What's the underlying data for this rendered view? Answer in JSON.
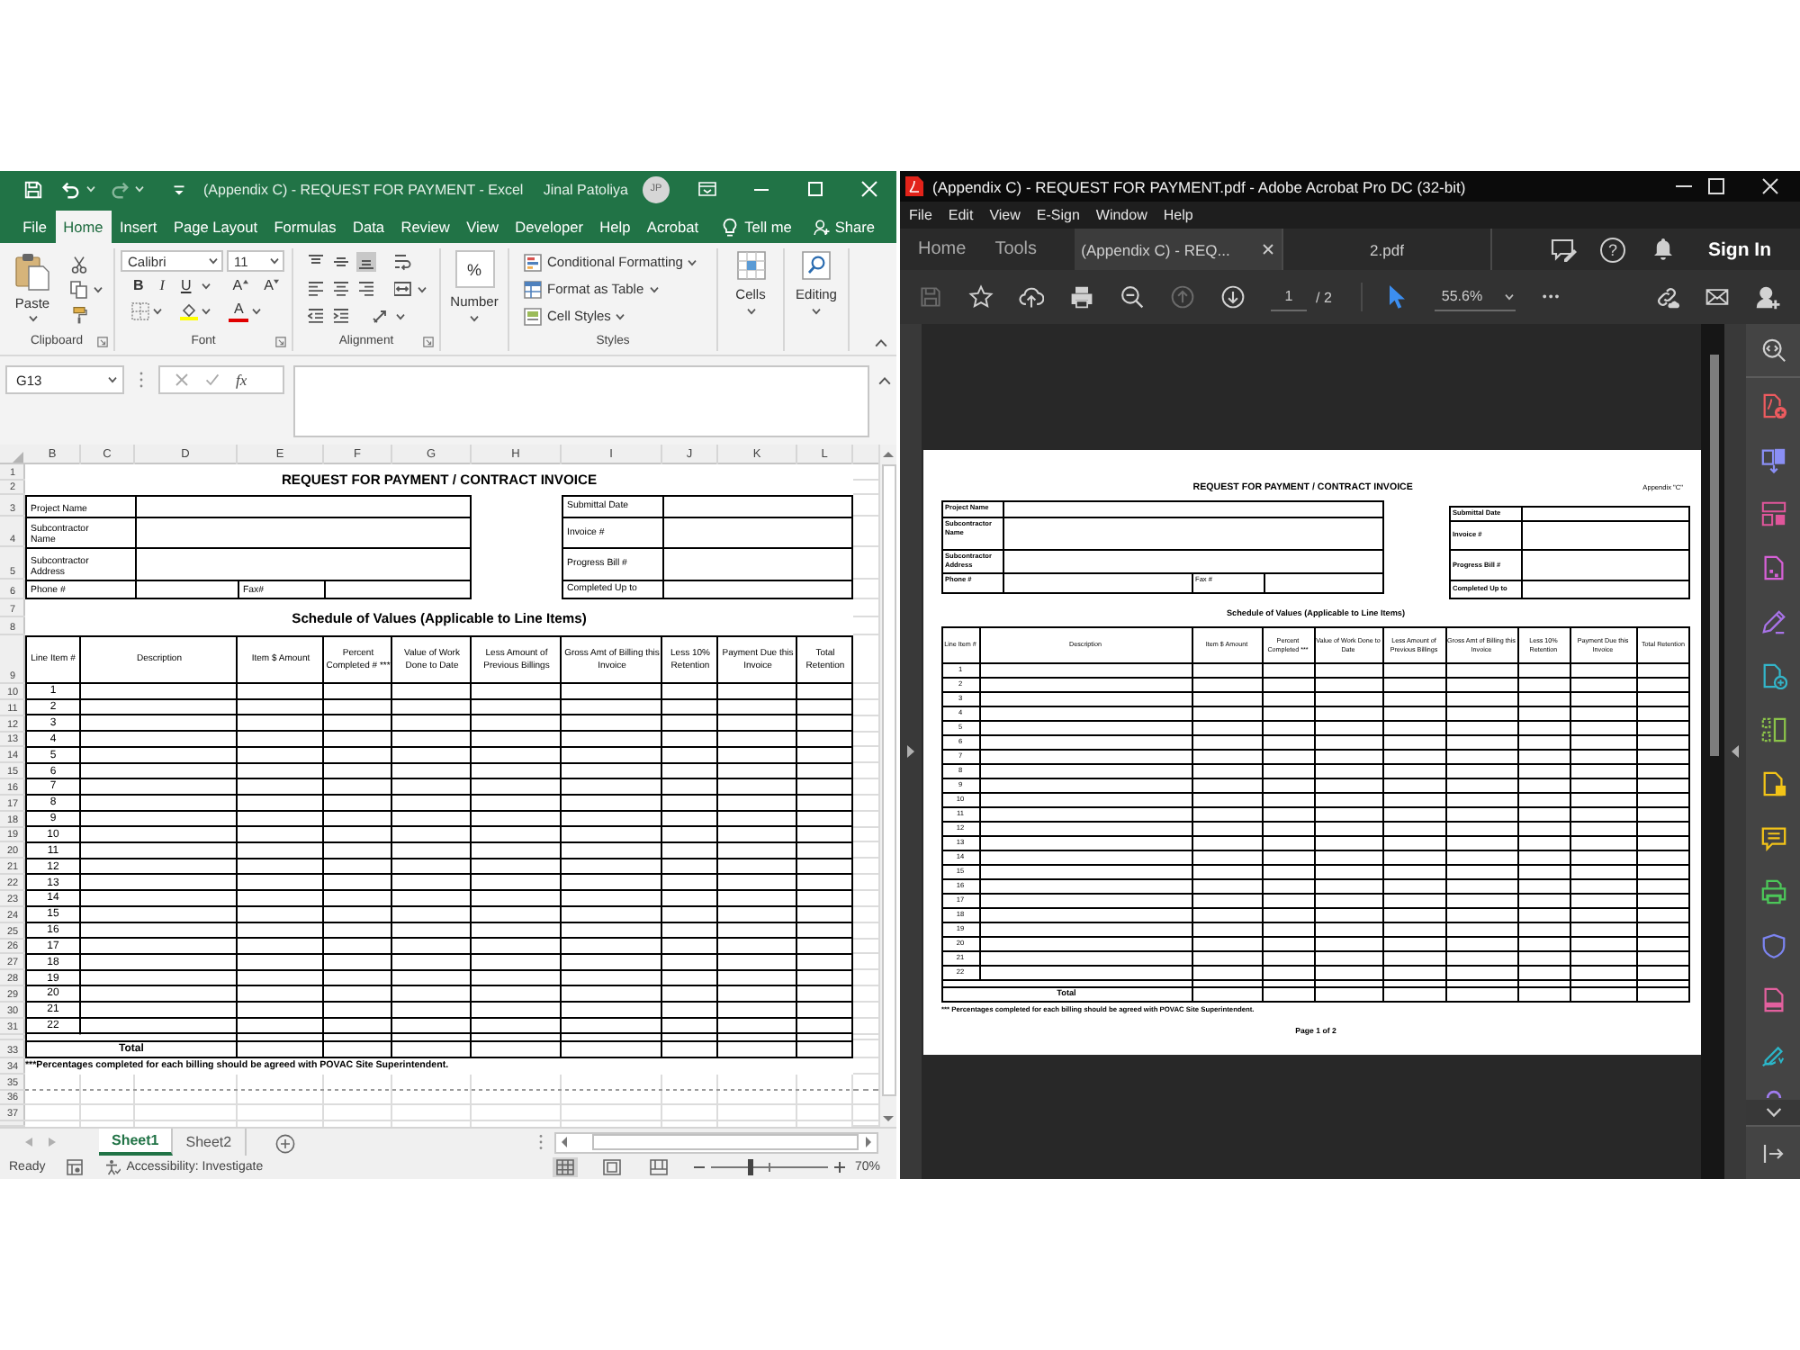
{
  "excel": {
    "quick_access": [
      {
        "disabled": false
      },
      {
        "disabled": false
      },
      {
        "disabled": true
      }
    ],
    "title": "(Appendix C) - REQUEST FOR PAYMENT - Excel",
    "user": "Jinal Patoliya",
    "avatar": "JP",
    "tabs": [
      {
        "label": "File",
        "selected": false
      },
      {
        "label": "Home",
        "selected": true
      },
      {
        "label": "Insert",
        "selected": false
      },
      {
        "label": "Page Layout",
        "selected": false
      },
      {
        "label": "Formulas",
        "selected": false
      },
      {
        "label": "Data",
        "selected": false
      },
      {
        "label": "Review",
        "selected": false
      },
      {
        "label": "View",
        "selected": false
      },
      {
        "label": "Developer",
        "selected": false
      },
      {
        "label": "Help",
        "selected": false
      },
      {
        "label": "Acrobat",
        "selected": false
      }
    ],
    "tell_me": "Tell me",
    "share": "Share",
    "ribbon": {
      "paste": "Paste",
      "clipboard_label": "Clipboard",
      "font_name": "Calibri",
      "font_size": "11",
      "bold": "B",
      "italic": "I",
      "underline": "U",
      "grow_font": "A",
      "shrink_font": "A",
      "font_color": "A",
      "font_label": "Font",
      "alignment_buttons": [
        {
          "on": false
        },
        {
          "on": false
        },
        {
          "on": true
        },
        {
          "on": false
        },
        {
          "on": false
        },
        {
          "on": false
        },
        {
          "on": false
        },
        {
          "on": false
        },
        {
          "on": false
        },
        {
          "on": false
        },
        {
          "on": false
        }
      ],
      "alignment_label": "Alignment",
      "number_symbol": "%",
      "number": "Number",
      "styles": [
        "Conditional Formatting",
        "Format as Table",
        "Cell Styles"
      ],
      "styles_label": "Styles",
      "cells": "Cells",
      "editing": "Editing"
    },
    "formula_bar": {
      "name_box": "G13",
      "function": "fx"
    },
    "sheet": {
      "columns": [
        "B",
        "C",
        "D",
        "E",
        "F",
        "G",
        "H",
        "I",
        "J",
        "K",
        "L"
      ],
      "row_numbers": [
        "1",
        "2",
        "3",
        "4",
        "5",
        "6",
        "7",
        "8",
        "9",
        "10",
        "11",
        "12",
        "13",
        "14",
        "15",
        "16",
        "17",
        "18",
        "19",
        "20",
        "21",
        "22",
        "23",
        "24",
        "25",
        "26",
        "27",
        "28",
        "29",
        "30",
        "31",
        "33",
        "34",
        "35",
        "36",
        "37"
      ],
      "form": {
        "title": "REQUEST FOR PAYMENT / CONTRACT INVOICE",
        "left_labels": [
          "Project Name",
          "Subcontractor Name",
          "Subcontractor Address",
          "Phone #"
        ],
        "fax_label": "Fax#",
        "right_labels": [
          "Submittal Date",
          "Invoice #",
          "Progress Bill #",
          "Completed Up to"
        ],
        "section_title": "Schedule of Values (Applicable to Line Items)",
        "columns": [
          "Line Item #",
          "Description",
          "Item $ Amount",
          "Percent Completed # ***",
          "Value of Work Done to Date",
          "Less Amount of Previous Billings",
          "Gross Amt of Billing this Invoice",
          "Less 10% Retention",
          "Payment Due this Invoice",
          "Total Retention"
        ],
        "line_items": [
          "1",
          "2",
          "3",
          "4",
          "5",
          "6",
          "7",
          "8",
          "9",
          "10",
          "11",
          "12",
          "13",
          "14",
          "15",
          "16",
          "17",
          "18",
          "19",
          "20",
          "21",
          "22"
        ],
        "total_label": "Total",
        "footnote": "***Percentages completed for each billing should be agreed with POVAC Site Superintendent."
      }
    },
    "sheet_tabs": [
      {
        "label": "Sheet1",
        "selected": true
      },
      {
        "label": "Sheet2",
        "selected": false
      }
    ],
    "status_bar": {
      "ready": "Ready",
      "accessibility": "Accessibility: Investigate",
      "views": [
        {
          "selected": true
        },
        {
          "selected": false
        },
        {
          "selected": false
        }
      ],
      "zoom_slider": {
        "level": 0.34
      },
      "zoom": "70%"
    }
  },
  "acrobat": {
    "title": "(Appendix C) - REQUEST FOR PAYMENT.pdf - Adobe Acrobat Pro DC (32-bit)",
    "menu": [
      "File",
      "Edit",
      "View",
      "E-Sign",
      "Window",
      "Help"
    ],
    "tabs": [
      {
        "label": "Home",
        "kind": "nav",
        "selected": false
      },
      {
        "label": "Tools",
        "kind": "nav",
        "selected": false
      },
      {
        "label": "(Appendix C) - REQ...",
        "kind": "document",
        "selected": true
      },
      {
        "label": "2.pdf",
        "kind": "document",
        "selected": false
      }
    ],
    "help": "?",
    "sign_in": "Sign In",
    "toolbar": {
      "buttons": [
        {
          "disabled": true
        },
        {
          "disabled": false
        },
        {
          "disabled": false
        },
        {
          "disabled": false
        },
        {
          "disabled": false
        },
        {
          "disabled": true
        },
        {
          "disabled": false
        }
      ],
      "page": "1",
      "page_total": "/ 2",
      "zoom": "55.6%",
      "more": "•••"
    },
    "page": {
      "title": "REQUEST FOR PAYMENT / CONTRACT INVOICE",
      "appendix": "Appendix \"C\"",
      "left_labels": [
        "Project Name",
        "Subcontractor Name",
        "Subcontractor Address",
        "Phone #"
      ],
      "fax_label": "Fax #",
      "right_labels": [
        "Submittal Date",
        "Invoice #",
        "Progress Bill #",
        "Completed Up to"
      ],
      "section_title": "Schedule of Values (Applicable to Line Items)",
      "columns": [
        "Line Item #",
        "Description",
        "Item $ Amount",
        "Percent Completed ***",
        "Value of Work Done to Date",
        "Less Amount of Previous Billings",
        "Gross Amt of Billing this Invoice",
        "Less 10% Retention",
        "Payment Due this Invoice",
        "Total Retention"
      ],
      "line_items": [
        "1",
        "2",
        "3",
        "4",
        "5",
        "6",
        "7",
        "8",
        "9",
        "10",
        "11",
        "12",
        "13",
        "14",
        "15",
        "16",
        "17",
        "18",
        "19",
        "20",
        "21",
        "22"
      ],
      "total_label": "Total",
      "footnote": "*** Percentages completed for each billing should be agreed with POVAC Site Superintendent.",
      "page_footer": "Page 1 of 2"
    }
  }
}
